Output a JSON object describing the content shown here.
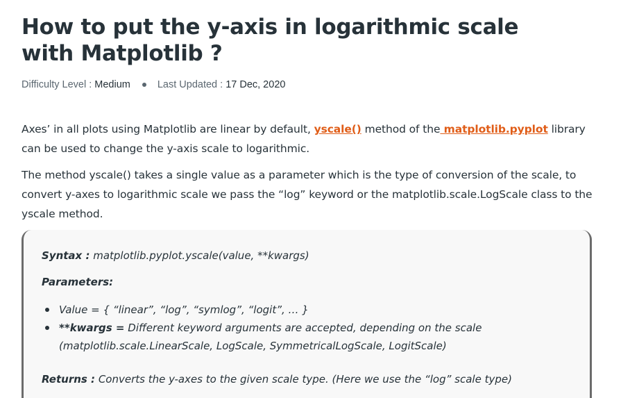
{
  "article": {
    "title": "How to put the y-axis in logarithmic scale with Matplotlib ?",
    "meta": {
      "difficulty_label": "Difficulty Level :",
      "difficulty_value": "Medium",
      "updated_label": "Last Updated :",
      "updated_value": "17 Dec, 2020"
    },
    "paragraph1": {
      "before": "Axes’ in all plots using Matplotlib are linear by default, ",
      "link1": "yscale()",
      "middle": " method of the",
      "link2": " matplotlib.pyplot",
      "after": " library can be used to change the y-axis scale to logarithmic."
    },
    "paragraph2": "The method yscale() takes a single value as a parameter which is the type of conversion of the scale, to convert y-axes to logarithmic scale we pass the “log” keyword or the matplotlib.scale.LogScale class to the yscale method."
  },
  "syntax_box": {
    "syntax_label": "Syntax :",
    "syntax_value": " matplotlib.pyplot.yscale(value, **kwargs)",
    "params_label": "Parameters:",
    "params": [
      {
        "label": "",
        "text": "Value = { “linear”, “log”, “symlog”, “logit”, … }"
      },
      {
        "label": "**kwargs =",
        "text": " Different keyword arguments are accepted, depending on the scale (matplotlib.scale.LinearScale, LogScale, SymmetricalLogScale, LogitScale)"
      }
    ],
    "returns_label": "Returns :",
    "returns_value": " Converts the y-axes to the given scale type. (Here we use the “log” scale type)"
  },
  "colors": {
    "text": "#273239",
    "link": "#e05d18",
    "box_bg": "#f8f8f8",
    "box_border": "#6b6b6b"
  }
}
